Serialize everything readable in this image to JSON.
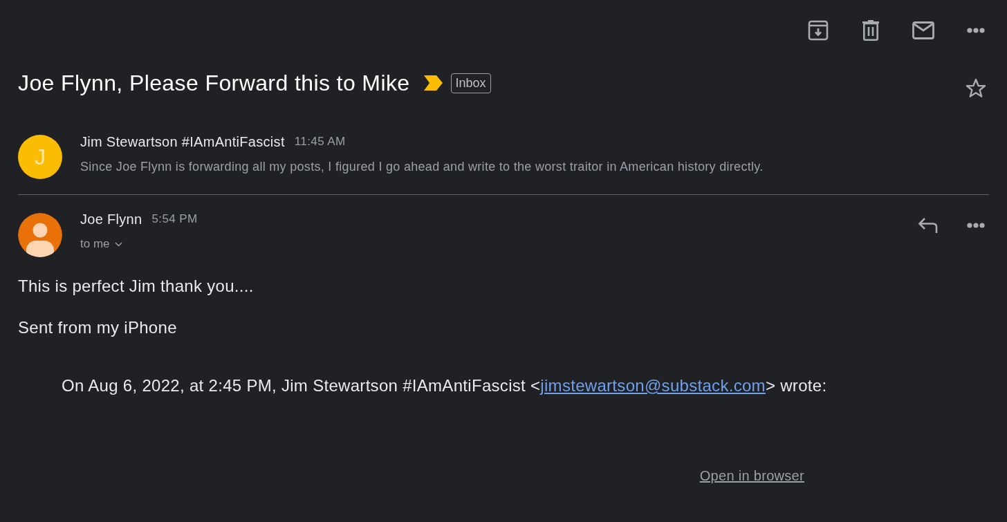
{
  "thread": {
    "subject": "Joe Flynn, Please Forward this to Mike",
    "important": true,
    "label": "Inbox",
    "starred": false
  },
  "messages": [
    {
      "kind": "collapsed",
      "sender": "Jim Stewartson #IAmAntiFascist",
      "time": "11:45 AM",
      "avatar": "J",
      "color": "#fbbc04",
      "snippet": "Since Joe Flynn is forwarding all my posts, I figured I go ahead and write to the worst traitor in American history directly."
    },
    {
      "kind": "expanded",
      "sender": "Joe Flynn",
      "time": "5:54 PM",
      "color": "#e8710a",
      "recipients": "to me",
      "body": [
        "This is perfect Jim thank you....",
        "Sent from my iPhone"
      ],
      "quote": {
        "before": "On Aug 6, 2022, at 2:45 PM, Jim Stewartson #IAmAntiFascist <",
        "link": "jimstewartson@substack.com",
        "after": "> wrote:"
      }
    }
  ],
  "footer": {
    "link": "Open in browser"
  }
}
